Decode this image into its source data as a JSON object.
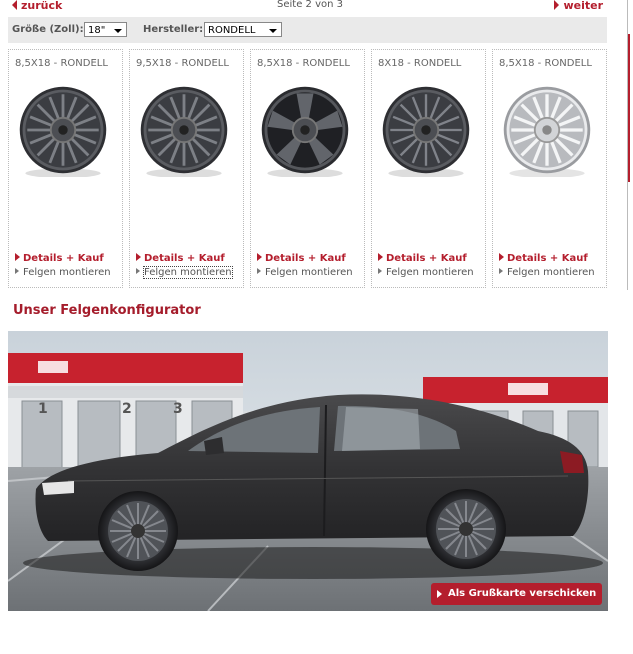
{
  "pager": {
    "prev_label": "zurück",
    "info": "Seite 2 von 3",
    "next_label": "weiter"
  },
  "filter": {
    "size_label": "Größe (Zoll):",
    "size_value": "18\"",
    "maker_label": "Hersteller:",
    "maker_value": "RONDELL"
  },
  "products": [
    {
      "title": "8,5X18 - RONDELL",
      "details_label": "Details + Kauf",
      "mount_label": "Felgen montieren",
      "finish": "anthracite"
    },
    {
      "title": "9,5X18 - RONDELL",
      "details_label": "Details + Kauf",
      "mount_label": "Felgen montieren",
      "finish": "anthracite"
    },
    {
      "title": "8,5X18 - RONDELL",
      "details_label": "Details + Kauf",
      "mount_label": "Felgen montieren",
      "finish": "anthracite-5-spoke"
    },
    {
      "title": "8X18 - RONDELL",
      "details_label": "Details + Kauf",
      "mount_label": "Felgen montieren",
      "finish": "anthracite"
    },
    {
      "title": "8,5X18 - RONDELL",
      "details_label": "Details + Kauf",
      "mount_label": "Felgen montieren",
      "finish": "silver"
    }
  ],
  "configurator": {
    "title": "Unser Felgenkonfigurator",
    "postcard_label": "Als Grußkarte verschicken",
    "bay_numbers": [
      "1",
      "2",
      "3"
    ]
  },
  "colors": {
    "accent": "#b41e2d",
    "filter_bg": "#eaeaea",
    "car": "#3a3a3a"
  }
}
